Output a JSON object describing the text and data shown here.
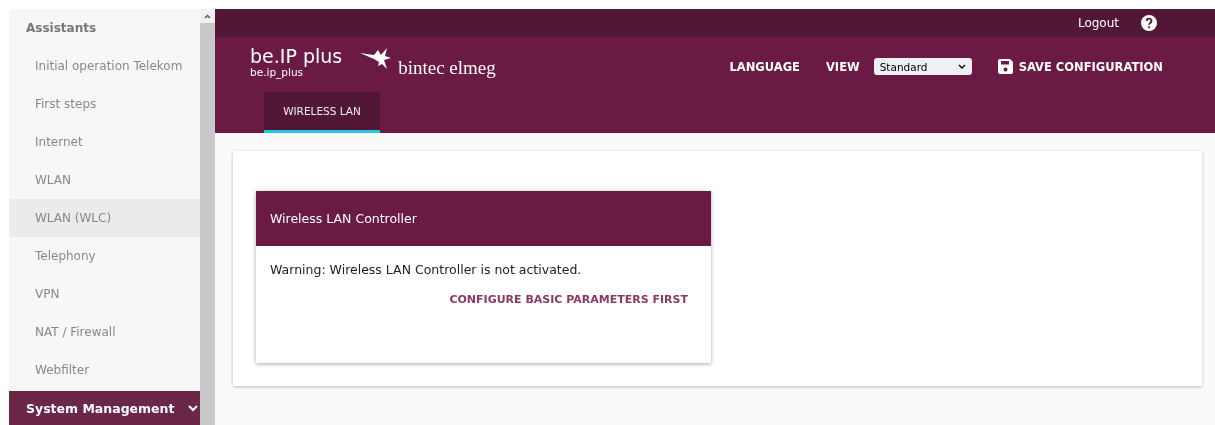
{
  "sidebar": {
    "heading": "Assistants",
    "items": [
      {
        "label": "Initial operation Telekom",
        "selected": false
      },
      {
        "label": "First steps",
        "selected": false
      },
      {
        "label": "Internet",
        "selected": false
      },
      {
        "label": "WLAN",
        "selected": false
      },
      {
        "label": "WLAN (WLC)",
        "selected": true
      },
      {
        "label": "Telephony",
        "selected": false
      },
      {
        "label": "VPN",
        "selected": false
      },
      {
        "label": "NAT / Firewall",
        "selected": false
      },
      {
        "label": "Webfilter",
        "selected": false
      }
    ],
    "section": "System Management"
  },
  "header": {
    "logout": "Logout",
    "product": "be.IP plus",
    "device": "be.ip_plus",
    "brand": "bintec elmeg",
    "language": "LANGUAGE",
    "view_label": "VIEW",
    "view_value": "Standard",
    "save": "SAVE CONFIGURATION"
  },
  "tabs": [
    {
      "label": "WIRELESS LAN",
      "selected": true
    }
  ],
  "card": {
    "title": "Wireless LAN Controller",
    "message": "Warning: Wireless LAN Controller is not activated.",
    "action": "CONFIGURE BASIC PARAMETERS FIRST"
  }
}
